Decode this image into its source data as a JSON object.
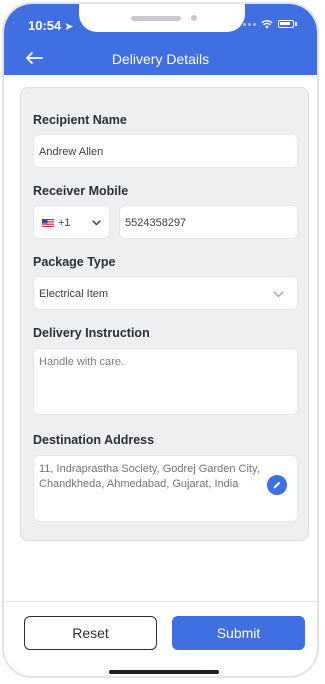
{
  "status_bar": {
    "time": "10:54"
  },
  "header": {
    "title": "Delivery Details"
  },
  "form": {
    "recipient_name": {
      "label": "Recipient Name",
      "value": "Andrew Allen"
    },
    "receiver_mobile": {
      "label": "Receiver Mobile",
      "country_code": "+1",
      "value": "5524358297"
    },
    "package_type": {
      "label": "Package Type",
      "value": "Electrical Item"
    },
    "delivery_instruction": {
      "label": "Delivery Instruction",
      "value": "Handle with care."
    },
    "destination_address": {
      "label": "Destination Address",
      "value": "11, Indraprastha Society, Godrej Garden City, Chandkheda, Ahmedabad, Gujarat, India"
    }
  },
  "footer": {
    "reset_label": "Reset",
    "submit_label": "Submit"
  },
  "colors": {
    "accent": "#3f6fe0",
    "card_bg": "#eeeff1",
    "text": "#2b2f36"
  },
  "icons": {
    "back": "arrow-left-icon",
    "flag": "us-flag-icon",
    "dropdown": "chevron-down-icon",
    "edit": "pencil-icon"
  }
}
